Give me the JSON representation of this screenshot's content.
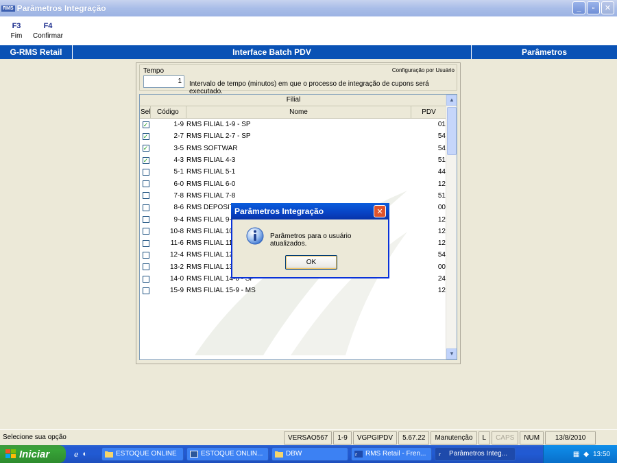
{
  "window": {
    "app_logo": "RMS",
    "title": "Parâmetros Integração"
  },
  "toolbar": [
    {
      "key": "F3",
      "label": "Fim"
    },
    {
      "key": "F4",
      "label": "Confirmar"
    }
  ],
  "header": {
    "left": "G-RMS Retail",
    "center": "Interface Batch PDV",
    "right": "Parâmetros"
  },
  "panel": {
    "tempo_label": "Tempo",
    "config_label": "Configuração por Usuário",
    "tempo_value": "1",
    "tempo_desc": "Intervalo de tempo (minutos) em que o processo de integração de cupons será executado.",
    "group_header": "Filial",
    "columns": {
      "sel": "Sel",
      "codigo": "Código",
      "nome": "Nome",
      "pdv": "PDV"
    },
    "rows": [
      {
        "checked": true,
        "codigo": "1-9",
        "nome": "RMS FILIAL 1-9 - SP",
        "pdv": "01"
      },
      {
        "checked": true,
        "codigo": "2-7",
        "nome": "RMS FILIAL 2-7 - SP",
        "pdv": "54"
      },
      {
        "checked": true,
        "codigo": "3-5",
        "nome": "RMS SOFTWAR",
        "pdv": "54"
      },
      {
        "checked": true,
        "codigo": "4-3",
        "nome": "RMS FILIAL 4-3",
        "pdv": "51"
      },
      {
        "checked": false,
        "codigo": "5-1",
        "nome": "RMS FILIAL 5-1",
        "pdv": "44"
      },
      {
        "checked": false,
        "codigo": "6-0",
        "nome": "RMS FILIAL 6-0",
        "pdv": "12"
      },
      {
        "checked": false,
        "codigo": "7-8",
        "nome": "RMS FILIAL 7-8",
        "pdv": "51"
      },
      {
        "checked": false,
        "codigo": "8-6",
        "nome": "RMS DEPOSITO",
        "pdv": "00"
      },
      {
        "checked": false,
        "codigo": "9-4",
        "nome": "RMS FILIAL 9-4 - GO",
        "pdv": "12"
      },
      {
        "checked": false,
        "codigo": "10-8",
        "nome": "RMS FILIAL 10-8 - SP",
        "pdv": "12"
      },
      {
        "checked": false,
        "codigo": "11-6",
        "nome": "RMS FILIAL 11-6 - PA",
        "pdv": "12"
      },
      {
        "checked": false,
        "codigo": "12-4",
        "nome": "RMS FILIAL 12-4 - SP",
        "pdv": "54"
      },
      {
        "checked": false,
        "codigo": "13-2",
        "nome": "RMS FILIAL 13-2 - SP",
        "pdv": "00"
      },
      {
        "checked": false,
        "codigo": "14-0",
        "nome": "RMS FILIAL 14-0 - SP",
        "pdv": "24"
      },
      {
        "checked": false,
        "codigo": "15-9",
        "nome": "RMS FILIAL 15-9 - MS",
        "pdv": "12"
      }
    ]
  },
  "dialog": {
    "title": "Parâmetros Integração",
    "message": "Parâmetros para o usuário atualizados.",
    "ok_label": "OK",
    "icon": "info-icon"
  },
  "statusbar": {
    "message": "Selecione sua opção",
    "version": "VERSAO567",
    "filial": "1-9",
    "program": "VGPGIPDV",
    "build": "5.67.22",
    "mode": "Manutenção",
    "l": "L",
    "caps": "CAPS",
    "num": "NUM",
    "date": "13/8/2010"
  },
  "taskbar": {
    "start_label": "Iniciar",
    "tasks": [
      {
        "label": "ESTOQUE ONLINE",
        "icon": "folder-icon"
      },
      {
        "label": "ESTOQUE ONLIN...",
        "icon": "word-icon"
      },
      {
        "label": "DBW",
        "icon": "folder-icon"
      },
      {
        "label": "RMS Retail - Fren...",
        "icon": "rms-icon"
      },
      {
        "label": "Parâmetros Integ...",
        "icon": "rms-icon"
      }
    ],
    "clock": "13:50"
  }
}
